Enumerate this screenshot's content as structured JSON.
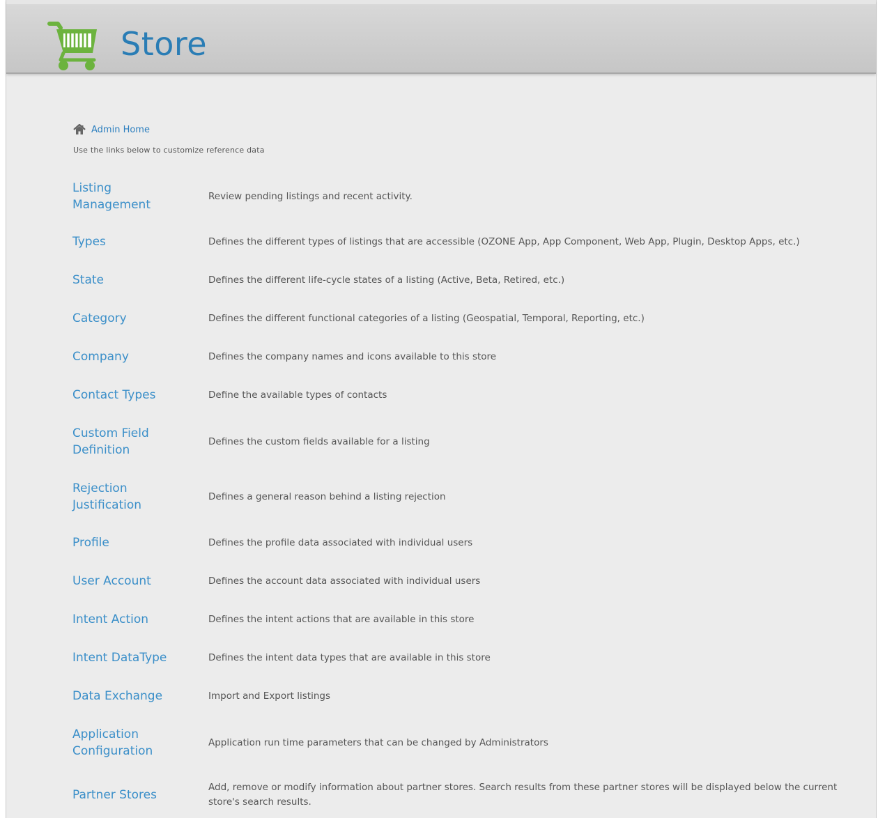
{
  "header": {
    "title": "Store",
    "logo_icon": "shopping-cart-icon",
    "logo_color": "#6cb33e",
    "title_color": "#2a7db5"
  },
  "breadcrumb": {
    "icon": "home-icon",
    "label": "Admin Home"
  },
  "intro": "Use the links below to customize reference data",
  "items": [
    {
      "label": "Listing Management",
      "description": "Review pending listings and recent activity."
    },
    {
      "label": "Types",
      "description": "Defines the different types of listings that are accessible (OZONE App, App Component, Web App, Plugin, Desktop Apps, etc.)"
    },
    {
      "label": "State",
      "description": "Defines the different life-cycle states of a listing (Active, Beta, Retired, etc.)"
    },
    {
      "label": "Category",
      "description": "Defines the different functional categories of a listing (Geospatial, Temporal, Reporting, etc.)"
    },
    {
      "label": "Company",
      "description": "Defines the company names and icons available to this store"
    },
    {
      "label": "Contact Types",
      "description": "Define the available types of contacts"
    },
    {
      "label": "Custom Field Definition",
      "description": "Defines the custom fields available for a listing"
    },
    {
      "label": "Rejection Justification",
      "description": "Defines a general reason behind a listing rejection"
    },
    {
      "label": "Profile",
      "description": "Defines the profile data associated with individual users"
    },
    {
      "label": "User Account",
      "description": "Defines the account data associated with individual users"
    },
    {
      "label": "Intent Action",
      "description": "Defines the intent actions that are available in this store"
    },
    {
      "label": "Intent DataType",
      "description": "Defines the intent data types that are available in this store"
    },
    {
      "label": "Data Exchange",
      "description": "Import and Export listings"
    },
    {
      "label": "Application Configuration",
      "description": "Application run time parameters that can be changed by Administrators"
    },
    {
      "label": "Partner Stores",
      "description": "Add, remove or modify information about partner stores. Search results from these partner stores will be displayed below the current store's search results."
    }
  ]
}
